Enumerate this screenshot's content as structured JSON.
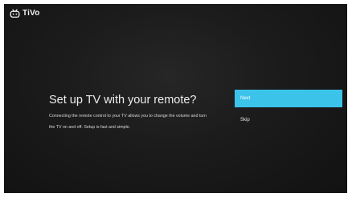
{
  "brand": {
    "name": "TiVo",
    "icon": "tivo-logo-icon"
  },
  "setup": {
    "title": "Set up TV with your remote?",
    "description": "Connecting the remote control to your TV allows you to change the volume and turn the TV on and off. Setup is fast and simple."
  },
  "actions": {
    "next_label": "Next",
    "skip_label": "Skip"
  },
  "colors": {
    "accent": "#3cc3ea",
    "background": "#1b1b1b",
    "text": "#ededed"
  }
}
